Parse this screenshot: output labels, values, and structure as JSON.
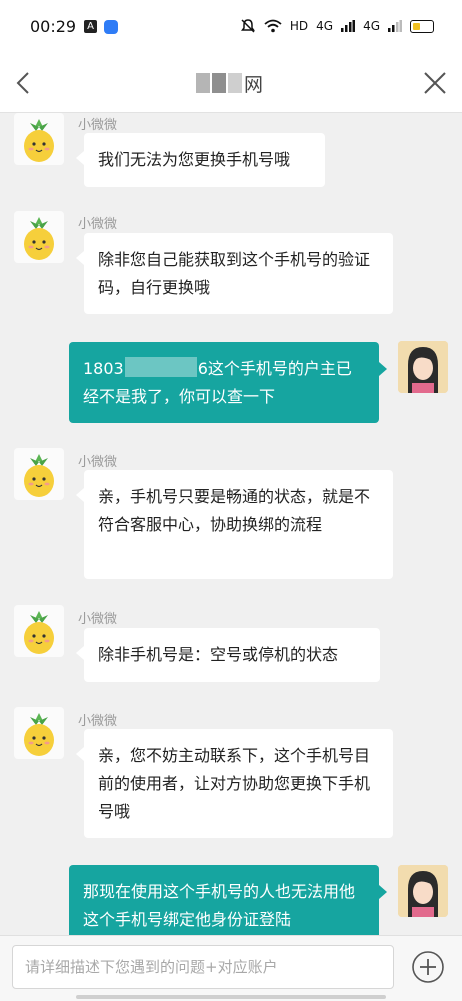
{
  "status_bar": {
    "time": "00:29",
    "app_icon_a": "A",
    "hd_label": "HD",
    "network_1": "4G",
    "network_2": "4G",
    "icons": [
      "mute-icon",
      "wifi-icon",
      "signal-icon",
      "battery-icon"
    ]
  },
  "header": {
    "title_visible": "网",
    "title_blurred": true
  },
  "messages": [
    {
      "side": "left",
      "sender": "小微微",
      "text": "我们无法为您更换手机号哦"
    },
    {
      "side": "left",
      "sender": "小微微",
      "text": "除非您自己能获取到这个手机号的验证码，自行更换哦"
    },
    {
      "side": "right",
      "text_prefix": "1803",
      "text_suffix": "6这个手机号的户主已经不是我了，你可以查一下"
    },
    {
      "side": "left",
      "sender": "小微微",
      "text": "亲，手机号只要是畅通的状态，就是不符合客服中心，协助换绑的流程"
    },
    {
      "side": "left",
      "sender": "小微微",
      "text": "除非手机号是：空号或停机的状态"
    },
    {
      "side": "left",
      "sender": "小微微",
      "text": "亲，您不妨主动联系下，这个手机号目前的使用者，让对方协助您更换下手机号哦"
    },
    {
      "side": "right",
      "text": "那现在使用这个手机号的人也无法用他这个手机号绑定他身份证登陆"
    }
  ],
  "input": {
    "placeholder": "请详细描述下您遇到的问题+对应账户",
    "value": ""
  },
  "colors": {
    "accent_bubble": "#16a5a0",
    "page_background": "#f0f0f0"
  }
}
